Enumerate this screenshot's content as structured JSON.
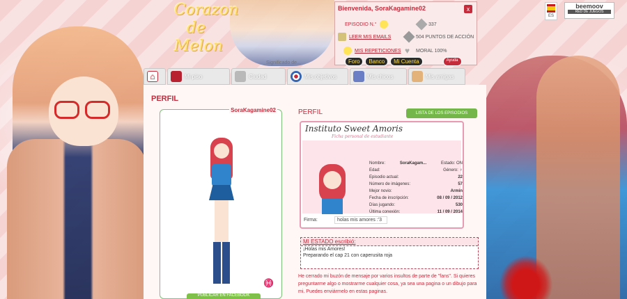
{
  "header": {
    "logo_lines": [
      "Corazon",
      "de",
      "Melon"
    ],
    "bio_link": "Significado de..."
  },
  "user_panel": {
    "welcome": "Bienvenida, SoraKagamine02",
    "close_label": "x",
    "episodio_label": "EPISODIO N.°",
    "episodio_value": "337",
    "mails_link": "LEER MIS EMAILS",
    "puntos": "504 PUNTOS DE ACCIÓN",
    "reps_link": "MIS REPETICIONES",
    "moral": "MORAL 100%",
    "tabs": [
      "Foro",
      "Banco",
      "Mi Cuenta"
    ],
    "ayuda": "Ayuda"
  },
  "flag": {
    "label": "ES"
  },
  "beemoov": {
    "brand": "beemoov",
    "tag": "RED DE JUEGOS"
  },
  "nav": {
    "items": [
      {
        "label": "",
        "color": "#ffffff"
      },
      {
        "label": "Mi piso",
        "color": "#b82230"
      },
      {
        "label": "Ciudad",
        "color": "#b9b9b9"
      },
      {
        "label": "Mis objetivos",
        "color": "#3565b2"
      },
      {
        "label": "Mis chicos",
        "color": "#6a7ec6"
      },
      {
        "label": "Mis amigas",
        "color": "#e3b27a"
      }
    ]
  },
  "profile": {
    "title": "PERFIL",
    "username": "SoraKagamine02",
    "sign": "♓",
    "facebook_btn": "PUBLICAR EN FACEBOOK",
    "sub_title": "PERFIL",
    "episodes_btn": "LISTA DE LOS EPISODIOS"
  },
  "card": {
    "title": "Instituto Sweet Amoris",
    "subtitle": "Ficha personal de estudiante",
    "rows": [
      {
        "k": "Nombre:",
        "v": "SoraKagam...",
        "extra": "Estado: ON"
      },
      {
        "k": "Edad:",
        "v": "",
        "extra": "Género: ♀"
      },
      {
        "k": "Episodio actual:",
        "v": "22",
        "extra": ""
      },
      {
        "k": "Número de imágenes:",
        "v": "57",
        "extra": ""
      },
      {
        "k": "Mejor novio:",
        "v": "Armin",
        "extra": ""
      },
      {
        "k": "Fecha de inscripción:",
        "v": "08 / 09 / 2012",
        "extra": ""
      },
      {
        "k": "Días jugando:",
        "v": "530",
        "extra": ""
      },
      {
        "k": "Última conexión:",
        "v": "11 / 09 / 2014",
        "extra": ""
      }
    ],
    "firma_label": "Firma:",
    "firma_value": "holas mis amores :'3"
  },
  "state": {
    "head": "MI ESTADO escribió:",
    "lines": [
      "¡Holas mis Amores!",
      "Preparando el cap 21 con caperusita roja"
    ]
  },
  "mensaje": "He cerrado mi buzón de mensaje por varios insultos de parte de \"fans\". Si quieres preguntarme algo o mostrarme cualquier cosa, ya sea una pagina o un dibujo para mi. Puedes enviármelo en estas paginas."
}
